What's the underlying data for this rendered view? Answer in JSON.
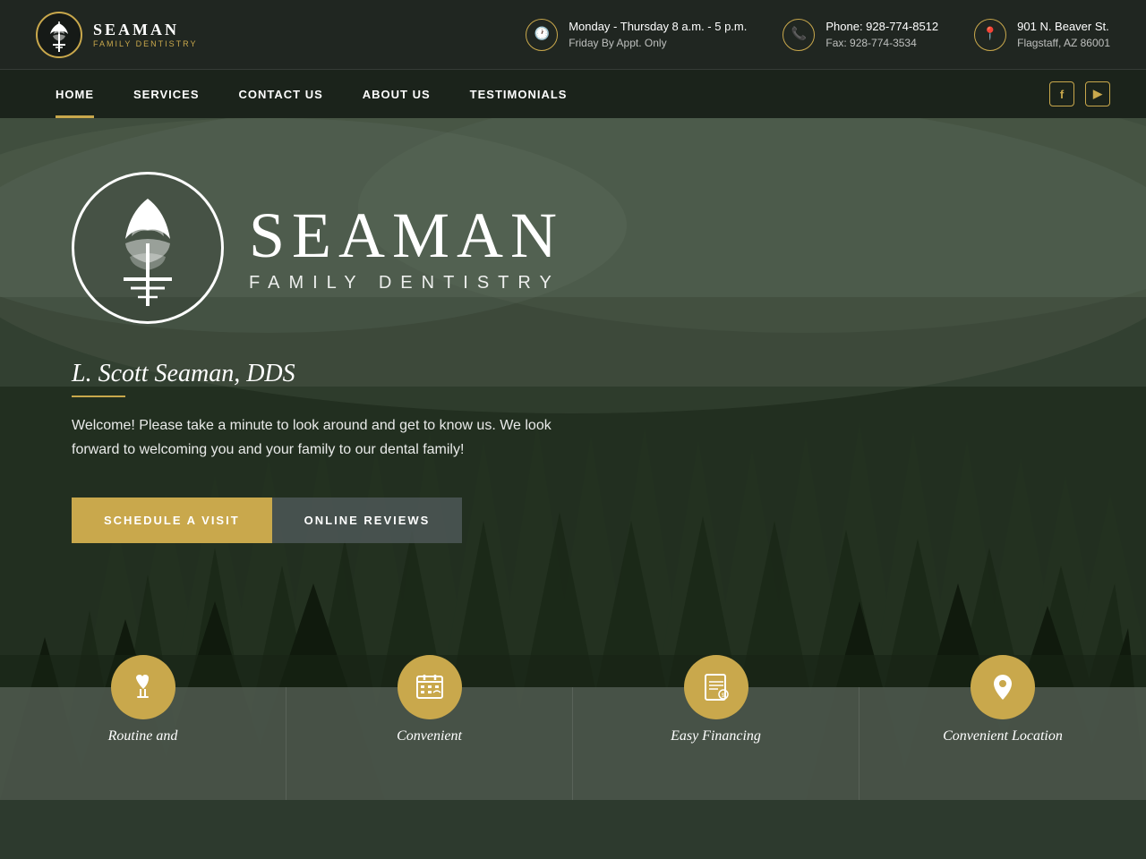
{
  "logo": {
    "name": "SEAMAN",
    "subtitle": "FAMILY DENTISTRY"
  },
  "topbar": {
    "hours_main": "Monday - Thursday 8 a.m. - 5 p.m.",
    "hours_sub": "Friday By Appt. Only",
    "phone_label": "Phone: 928-774-8512",
    "fax_label": "Fax: 928-774-3534",
    "address_line1": "901 N. Beaver St.",
    "address_line2": "Flagstaff, AZ 86001"
  },
  "nav": {
    "items": [
      "HOME",
      "SERVICES",
      "CONTACT US",
      "ABOUT US",
      "TESTIMONIALS"
    ]
  },
  "hero": {
    "big_name": "SEAMAN",
    "big_sub": "FAMILY DENTISTRY",
    "doctor": "L. Scott Seaman, DDS",
    "welcome": "Welcome! Please take a minute to look around and get to know us. We look forward to welcoming you and your family to our dental family!",
    "btn_schedule": "SCHEDULE A VISIT",
    "btn_reviews": "ONLINE REVIEWS"
  },
  "features": [
    {
      "label": "Routine and",
      "icon": "🦷"
    },
    {
      "label": "Convenient",
      "icon": "📅"
    },
    {
      "label": "Easy Financing",
      "icon": "📋"
    },
    {
      "label": "Convenient Location",
      "icon": "📍"
    }
  ],
  "social": {
    "facebook": "f",
    "youtube": "▶"
  }
}
